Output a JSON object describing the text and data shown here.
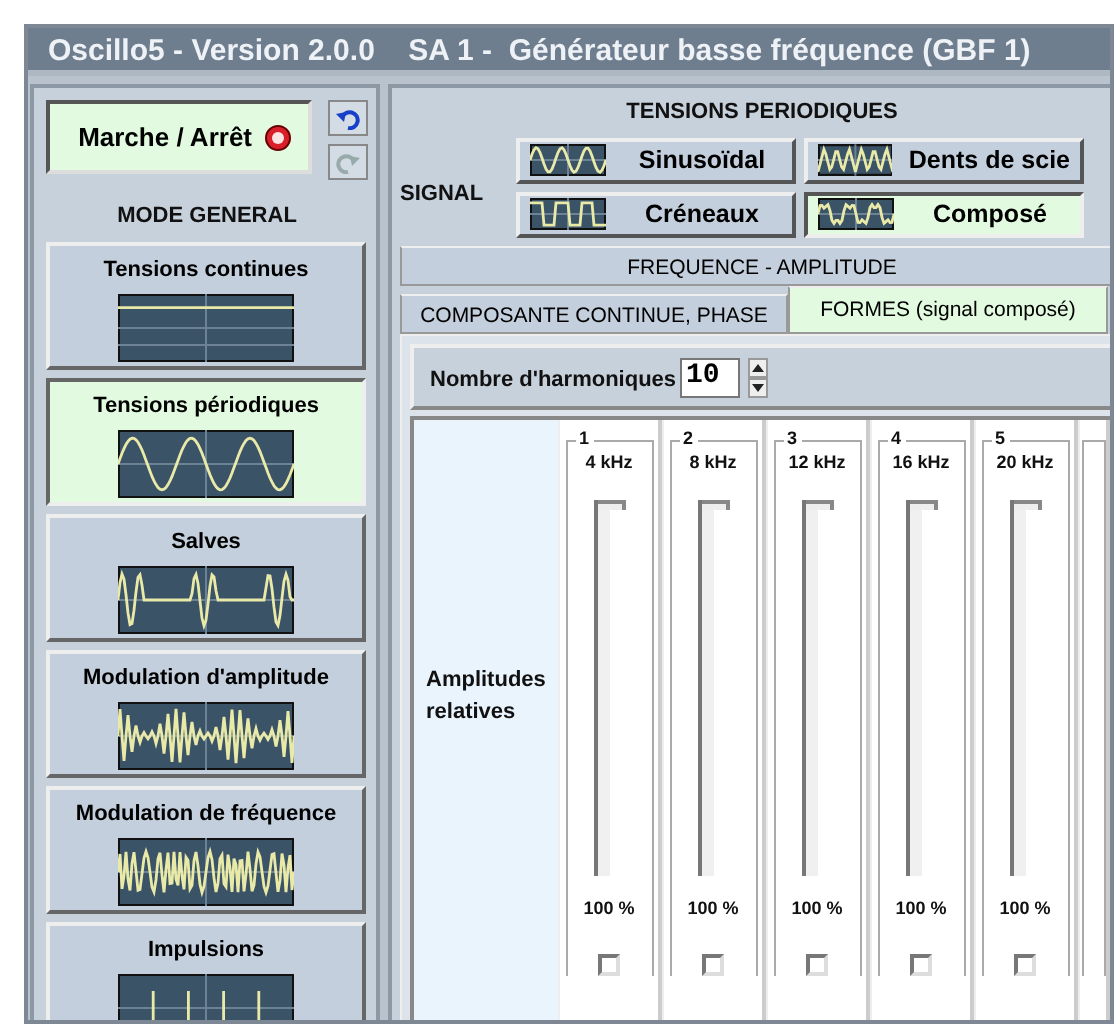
{
  "window": {
    "title": "Oscillo5 - Version 2.0.0    SA 1 -  Générateur basse fréquence (GBF 1)"
  },
  "left_panel": {
    "power_button": {
      "label": "Marche / Arrêt"
    },
    "history_buttons": [
      {
        "kind": "undo",
        "disabled": false
      },
      {
        "kind": "redo",
        "disabled": true
      }
    ],
    "mode_title": "MODE GENERAL",
    "modes": [
      {
        "label": "Tensions continues",
        "kind": "dc",
        "selected": false
      },
      {
        "label": "Tensions périodiques",
        "kind": "sine",
        "selected": true
      },
      {
        "label": "Salves",
        "kind": "burst",
        "selected": false
      },
      {
        "label": "Modulation d'amplitude",
        "kind": "am",
        "selected": false
      },
      {
        "label": "Modulation de fréquence",
        "kind": "fm",
        "selected": false
      },
      {
        "label": "Impulsions",
        "kind": "pulse",
        "selected": false
      }
    ]
  },
  "right_panel": {
    "title": "TENSIONS PERIODIQUES",
    "signal_label": "SIGNAL",
    "signals": [
      {
        "label": "Sinusoïdal",
        "kind": "sine",
        "selected": false
      },
      {
        "label": "Dents de scie",
        "kind": "saw",
        "selected": false
      },
      {
        "label": "Créneaux",
        "kind": "square",
        "selected": false
      },
      {
        "label": "Composé",
        "kind": "composite",
        "selected": true
      }
    ],
    "tabs_row_1": [
      {
        "label": "FREQUENCE - AMPLITUDE",
        "selected": false
      }
    ],
    "tabs_row_2": [
      {
        "label": "COMPOSANTE CONTINUE, PHASE",
        "selected": false
      },
      {
        "label": "FORMES (signal composé)",
        "selected": true
      }
    ],
    "harmonics": {
      "label": "Nombre d'harmoniques",
      "value": "10"
    },
    "amplitudes_label": "Amplitudes relatives",
    "harmonic_sliders": [
      {
        "number": "1",
        "frequency": "4 kHz",
        "level": 1,
        "reading": "100 %",
        "checked": false
      },
      {
        "number": "2",
        "frequency": "8 kHz",
        "level": 1,
        "reading": "100 %",
        "checked": false
      },
      {
        "number": "3",
        "frequency": "12 kHz",
        "level": 1,
        "reading": "100 %",
        "checked": false
      },
      {
        "number": "4",
        "frequency": "16 kHz",
        "level": 1,
        "reading": "100 %",
        "checked": false
      },
      {
        "number": "5",
        "frequency": "20 kHz",
        "level": 1,
        "reading": "100 %",
        "checked": false
      }
    ]
  }
}
